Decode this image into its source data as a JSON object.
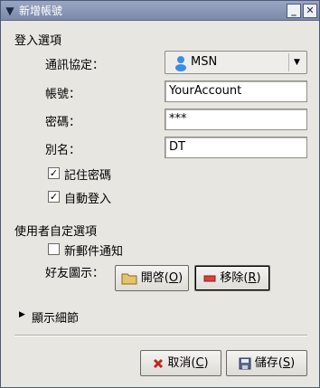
{
  "window": {
    "title": "新增帳號"
  },
  "login_section": {
    "heading": "登入選項",
    "protocol_label": "通訊協定：",
    "protocol_value": "MSN",
    "account_label": "帳號：",
    "account_value": "YourAccount",
    "password_label": "密碼：",
    "password_value": "***",
    "alias_label": "別名：",
    "alias_value": "DT",
    "remember_password_label": "記住密碼",
    "remember_password_checked": true,
    "auto_login_label": "自動登入",
    "auto_login_checked": true
  },
  "user_section": {
    "heading": "使用者自定選項",
    "new_mail_label": "新郵件通知",
    "new_mail_checked": false,
    "buddy_icon_label": "好友圖示：",
    "open_button": {
      "text": "開啓(",
      "mnemonic": "O",
      "close": ")"
    },
    "remove_button": {
      "text": "移除(",
      "mnemonic": "R",
      "close": ")"
    }
  },
  "expander": {
    "label": "顯示細節"
  },
  "footer": {
    "cancel_button": {
      "text": "取消(",
      "mnemonic": "C",
      "close": ")"
    },
    "save_button": {
      "text": "儲存(",
      "mnemonic": "S",
      "close": ")"
    }
  }
}
